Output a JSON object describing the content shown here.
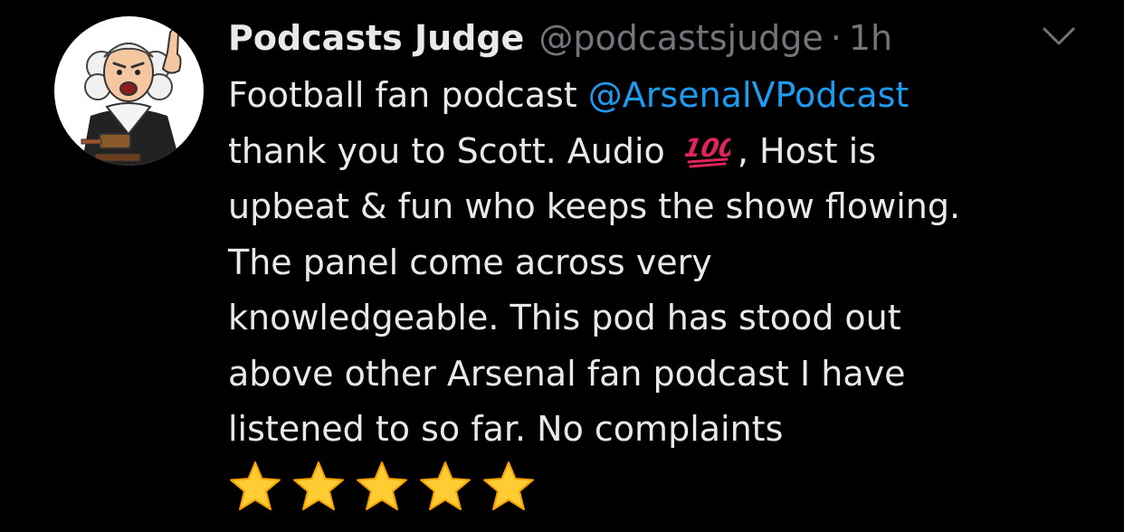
{
  "tweet": {
    "author_name": "Podcasts Judge",
    "author_handle": "@podcastsjudge",
    "separator": "·",
    "timestamp": "1h",
    "avatar_icon": "cartoon-judge-avatar",
    "menu_icon": "chevron-down-icon",
    "body": {
      "line1_prefix": "Football fan podcast ",
      "mention": "@ArsenalVPodcast",
      "line2_prefix": "thank you to Scott. Audio ",
      "line2_emoji": "hundred-points-emoji",
      "line2_suffix": ", Host is",
      "line3": "upbeat & fun who keeps the show flowing.",
      "line4": "The panel come across very",
      "line5": "knowledgeable. This pod has stood out",
      "line6": "above other Arsenal fan podcast I have",
      "line7": "listened to so far. No complaints"
    },
    "rating_stars": 5,
    "star_icon": "star-emoji"
  },
  "colors": {
    "background": "#000000",
    "text": "#e7e9ea",
    "secondary_text": "#71767b",
    "mention": "#1d9bf0",
    "star": "#ffcc33",
    "hundred_emoji": "#e0245e"
  }
}
